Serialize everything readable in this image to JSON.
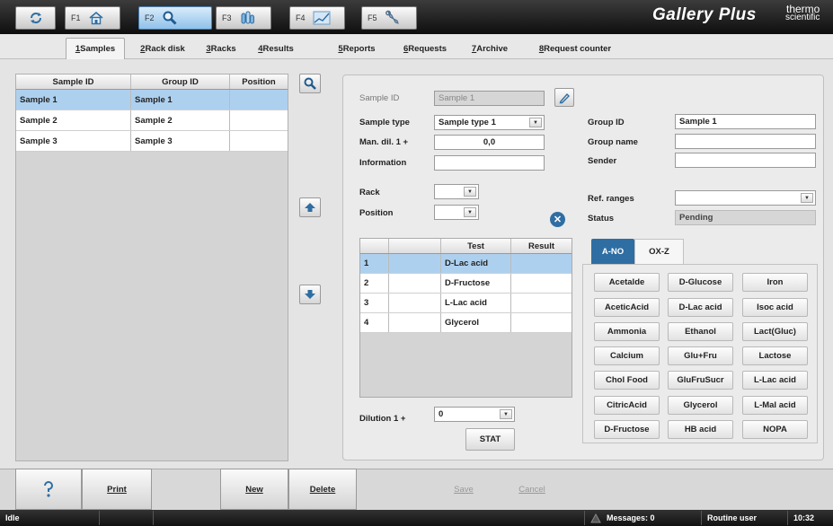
{
  "topbar": {
    "keys": [
      {
        "label": "F1",
        "icon": "home-icon"
      },
      {
        "label": "F2",
        "icon": "search-icon"
      },
      {
        "label": "F3",
        "icon": "sample-tubes-icon"
      },
      {
        "label": "F4",
        "icon": "chart-icon"
      },
      {
        "label": "F5",
        "icon": "wrench-icon"
      }
    ],
    "refresh_icon": "refresh-icon",
    "brand": "Gallery Plus",
    "maker_line1": "thermo",
    "maker_line2": "scientific"
  },
  "tabs": [
    {
      "num": "1",
      "label": " Samples"
    },
    {
      "num": "2",
      "label": " Rack disk"
    },
    {
      "num": "3",
      "label": " Racks"
    },
    {
      "num": "4",
      "label": " Results"
    },
    {
      "num": "5",
      "label": " Reports"
    },
    {
      "num": "6",
      "label": " Requests"
    },
    {
      "num": "7",
      "label": " Archive"
    },
    {
      "num": "8",
      "label": " Request counter"
    }
  ],
  "samples_table": {
    "columns": [
      "Sample ID",
      "Group ID",
      "Position"
    ],
    "rows": [
      [
        "Sample 1",
        "Sample 1",
        ""
      ],
      [
        "Sample 2",
        "Sample 2",
        ""
      ],
      [
        "Sample 3",
        "Sample 3",
        ""
      ]
    ]
  },
  "form": {
    "sample_id_label": "Sample ID",
    "sample_id_value": "Sample 1",
    "sample_type_label": "Sample type",
    "sample_type_value": "Sample type 1",
    "man_dil_label": "Man. dil. 1 +",
    "man_dil_value": "0,0",
    "information_label": "Information",
    "information_value": "",
    "rack_label": "Rack",
    "rack_value": "",
    "position_label": "Position",
    "position_value": "",
    "group_id_label": "Group ID",
    "group_id_value": "Sample 1",
    "group_name_label": "Group name",
    "group_name_value": "",
    "sender_label": "Sender",
    "sender_value": "",
    "ref_ranges_label": "Ref. ranges",
    "ref_ranges_value": "",
    "status_label": "Status",
    "status_value": "Pending",
    "dilution_label": "Dilution 1 +",
    "dilution_value": "0",
    "stat_label": "STAT"
  },
  "tests_table": {
    "columns": [
      "",
      "",
      "Test",
      "Result"
    ],
    "rows": [
      [
        "1",
        "",
        "D-Lac acid",
        ""
      ],
      [
        "2",
        "",
        "D-Fructose",
        ""
      ],
      [
        "3",
        "",
        "L-Lac acid",
        ""
      ],
      [
        "4",
        "",
        "Glycerol",
        ""
      ]
    ]
  },
  "test_groups": [
    "A-NO",
    "OX-Z"
  ],
  "test_buttons": [
    [
      "Acetalde",
      "D-Glucose",
      "Iron"
    ],
    [
      "AceticAcid",
      "D-Lac acid",
      "Isoc acid"
    ],
    [
      "Ammonia",
      "Ethanol",
      "Lact(Gluc)"
    ],
    [
      "Calcium",
      "Glu+Fru",
      "Lactose"
    ],
    [
      "Chol Food",
      "GluFruSucr",
      "L-Lac acid"
    ],
    [
      "CitricAcid",
      "Glycerol",
      "L-Mal acid"
    ],
    [
      "D-Fructose",
      "HB acid",
      "NOPA"
    ]
  ],
  "bottom": {
    "print": "Print",
    "new": "New",
    "delete": "Delete",
    "save": "Save",
    "cancel": "Cancel"
  },
  "statusbar": {
    "state": "Idle",
    "messages": "Messages: 0",
    "user": "Routine user",
    "time": "10:32"
  },
  "colors": {
    "selection": "#aed0ef",
    "active_tab": "#8fc1ea",
    "accent_button": "#2f6ea3"
  }
}
